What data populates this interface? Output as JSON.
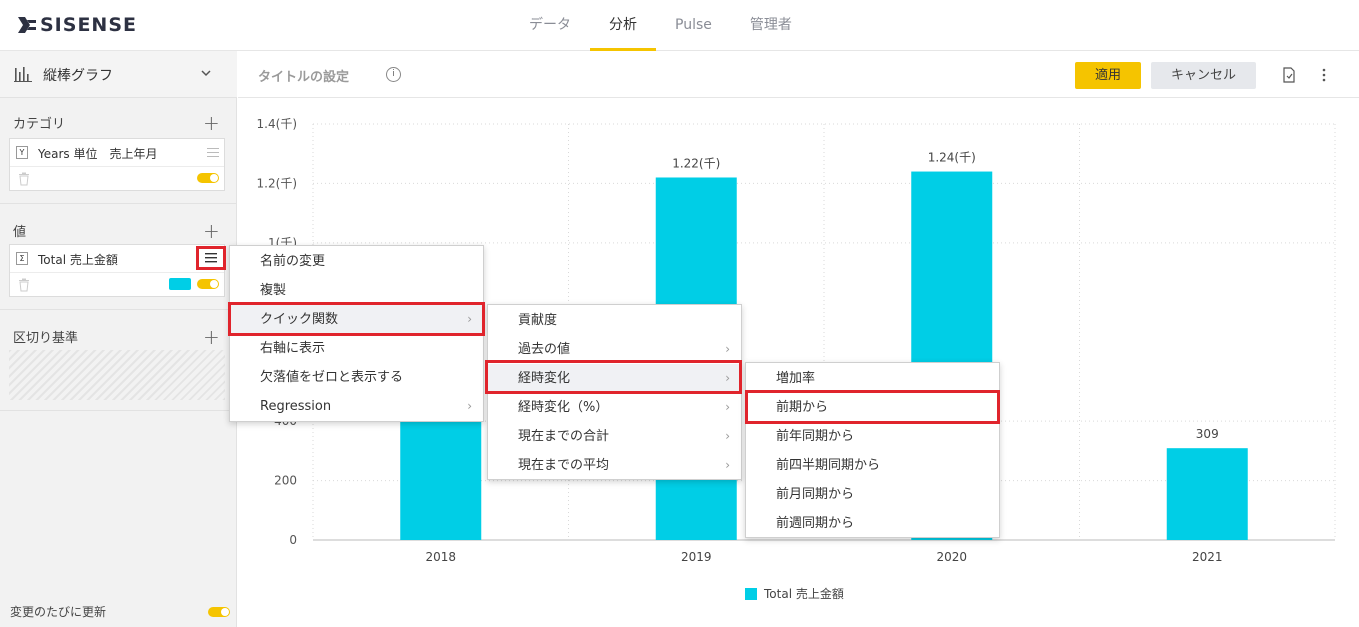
{
  "app": {
    "logo_text": "SISENSE",
    "nav": [
      "データ",
      "分析",
      "Pulse",
      "管理者"
    ],
    "active_nav": 1
  },
  "left_panel": {
    "widget_type": "縦棒グラフ",
    "category_section": "カテゴリ",
    "category_field": {
      "badge": "Y",
      "label": "Years 単位　売上年月"
    },
    "value_section": "値",
    "value_field": {
      "badge": "Σ",
      "label": "Total 売上金額"
    },
    "breakby_section": "区切り基準",
    "auto_update_label": "変更のたびに更新",
    "series_color": "#00cee6"
  },
  "header": {
    "title_placeholder": "タイトルの設定",
    "apply_label": "適用",
    "cancel_label": "キャンセル"
  },
  "menu1": [
    "名前の変更",
    "複製",
    "クイック関数",
    "右軸に表示",
    "欠落値をゼロと表示する",
    "Regression"
  ],
  "menu2": [
    "貢献度",
    "過去の値",
    "経時変化",
    "経時変化（%）",
    "現在までの合計",
    "現在までの平均"
  ],
  "menu3": [
    "増加率",
    "前期から",
    "前年同期から",
    "前四半期同期から",
    "前月同期から",
    "前週同期から"
  ],
  "chart_data": {
    "type": "bar",
    "categories": [
      "2018",
      "2019",
      "2020",
      "2021"
    ],
    "series": [
      {
        "name": "Total 売上金額",
        "values": [
          600,
          1220,
          1240,
          309
        ]
      }
    ],
    "value_labels": [
      "",
      "1.22(千)",
      "1.24(千)",
      "309"
    ],
    "y_ticks": [
      {
        "v": 0,
        "label": "0"
      },
      {
        "v": 200,
        "label": "200"
      },
      {
        "v": 400,
        "label": "400"
      },
      {
        "v": 1000,
        "label": "1(千)"
      },
      {
        "v": 1200,
        "label": "1.2(千)"
      },
      {
        "v": 1400,
        "label": "1.4(千)"
      }
    ],
    "ylim": [
      0,
      1400
    ],
    "grid": true,
    "legend": "bottom",
    "color": "#00cee6"
  }
}
